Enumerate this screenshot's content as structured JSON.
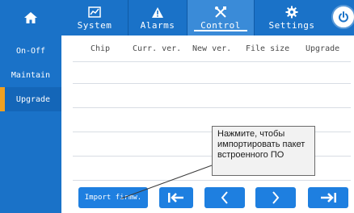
{
  "header": {
    "tabs": [
      {
        "label": "System",
        "icon": "chart-icon"
      },
      {
        "label": "Alarms",
        "icon": "warning-icon"
      },
      {
        "label": "Control",
        "icon": "tools-icon"
      },
      {
        "label": "Settings",
        "icon": "gear-icon"
      }
    ],
    "active_tab": "Control"
  },
  "sidebar": {
    "items": [
      {
        "label": "On-Off"
      },
      {
        "label": "Maintain"
      },
      {
        "label": "Upgrade"
      }
    ],
    "active_item": "Upgrade"
  },
  "table": {
    "columns": [
      "Chip",
      "Curr. ver.",
      "New ver.",
      "File size",
      "Upgrade"
    ],
    "rows": []
  },
  "footer": {
    "import_label": "Import firmw."
  },
  "tooltip": {
    "text": "Нажмите, чтобы импортировать пакет встроенного ПО"
  },
  "colors": {
    "primary": "#1a72c8",
    "button": "#1e7fe0",
    "accent": "#f0a020"
  }
}
